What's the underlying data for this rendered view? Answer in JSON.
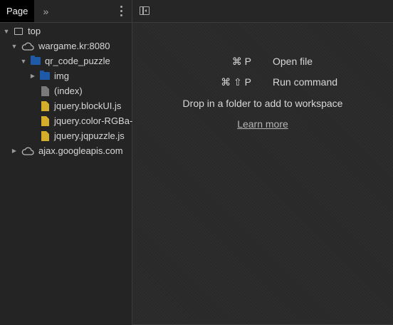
{
  "left_panel": {
    "tab_label": "Page",
    "more_tabs_glyph": "»",
    "tree": [
      {
        "label": "top",
        "icon": "frame-icon",
        "expand": "▼",
        "depth": 0
      },
      {
        "label": "wargame.kr:8080",
        "icon": "cloud-icon",
        "expand": "▼",
        "depth": 1
      },
      {
        "label": "qr_code_puzzle",
        "icon": "folder-icon",
        "expand": "▼",
        "depth": 2
      },
      {
        "label": "img",
        "icon": "folder-icon",
        "expand": "▶",
        "depth": 3
      },
      {
        "label": "(index)",
        "icon": "document-icon",
        "expand": "",
        "depth": 3
      },
      {
        "label": "jquery.blockUI.js",
        "icon": "script-icon",
        "expand": "",
        "depth": 3
      },
      {
        "label": "jquery.color-RGBa-p",
        "icon": "script-icon",
        "expand": "",
        "depth": 3
      },
      {
        "label": "jquery.jqpuzzle.js",
        "icon": "script-icon",
        "expand": "",
        "depth": 3
      },
      {
        "label": "ajax.googleapis.com",
        "icon": "cloud-icon",
        "expand": "▶",
        "depth": 1
      }
    ]
  },
  "right_panel": {
    "shortcuts": [
      {
        "keys": "⌘ P",
        "label": "Open file"
      },
      {
        "keys": "⌘ ⇧ P",
        "label": "Run command"
      }
    ],
    "drop_text": "Drop in a folder to add to workspace",
    "learn_more": "Learn more"
  },
  "colors": {
    "folder": "#1e5aa8",
    "script_file": "#d4ad2b",
    "document_file": "#7a7a7a",
    "background": "#292929"
  }
}
